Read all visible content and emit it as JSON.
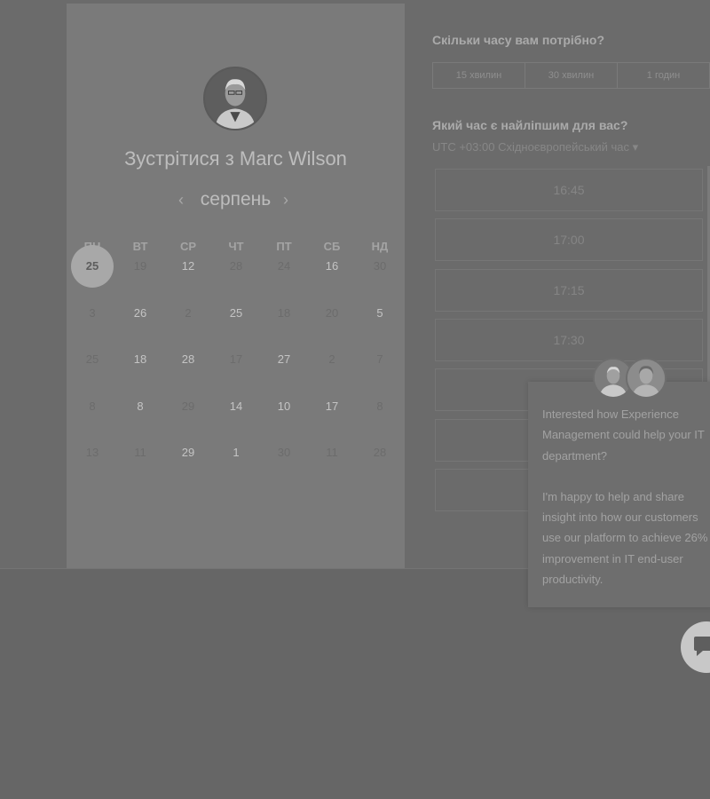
{
  "booking": {
    "title": "Зустрітися з Marc Wilson",
    "month": "серпень",
    "prev_icon": "chevron-left-icon",
    "next_icon": "chevron-right-icon",
    "weekdays": [
      "ПН",
      "ВТ",
      "СР",
      "ЧТ",
      "ПТ",
      "СБ",
      "НД"
    ],
    "weeks": [
      [
        "25",
        "19",
        "12",
        "28",
        "24",
        "16",
        "30"
      ],
      [
        "3",
        "26",
        "2",
        "25",
        "18",
        "20",
        "5"
      ],
      [
        "25",
        "18",
        "28",
        "17",
        "27",
        "2",
        "7"
      ],
      [
        "8",
        "8",
        "29",
        "14",
        "10",
        "17",
        "8"
      ],
      [
        "13",
        "11",
        "29",
        "1",
        "30",
        "11",
        "28"
      ]
    ],
    "selected_day": "25"
  },
  "duration": {
    "question": "Скільки часу вам потрібно?",
    "options": [
      "15 хвилин",
      "30 хвилин",
      "1 годин"
    ]
  },
  "time": {
    "question": "Який час є найліпшим для вас?",
    "timezone": "UTC +03:00 Східноєвропейський час ▾",
    "slots": [
      "16:45",
      "17:00",
      "17:15",
      "17:30"
    ]
  },
  "chat": {
    "message_1": "Interested how Experience Management could help your IT department?",
    "message_2": "I'm happy to help and share insight into how our customers use our platform to achieve 26% improvement in IT end-user productivity.",
    "bubble_icon": "chat-bubble-icon"
  },
  "colors": {
    "overlay": "#666666",
    "card": "#7a7a7a",
    "selected_circle": "#a8a8a8"
  }
}
